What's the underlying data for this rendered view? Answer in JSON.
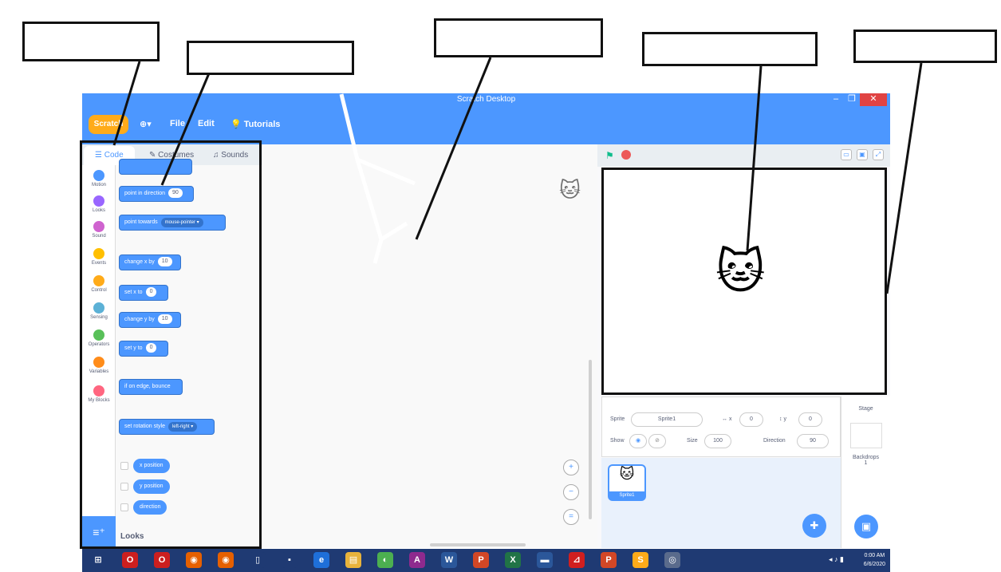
{
  "window": {
    "title": "Scratch Desktop",
    "controls": [
      "–",
      "❐",
      "✕"
    ]
  },
  "menubar": {
    "logo": "Scratch",
    "globe": "⊕▾",
    "items": [
      "File",
      "Edit",
      "Tutorials"
    ]
  },
  "tabs": [
    "Code",
    "Costumes",
    "Sounds"
  ],
  "categories": [
    {
      "label": "Motion",
      "color": "#4c97ff"
    },
    {
      "label": "Looks",
      "color": "#9966ff"
    },
    {
      "label": "Sound",
      "color": "#cf63cf"
    },
    {
      "label": "Events",
      "color": "#ffbf00"
    },
    {
      "label": "Control",
      "color": "#ffab19"
    },
    {
      "label": "Sensing",
      "color": "#5cb1d6"
    },
    {
      "label": "Operators",
      "color": "#59c059"
    },
    {
      "label": "Variables",
      "color": "#ff8c1a"
    },
    {
      "label": "My Blocks",
      "color": "#ff6680"
    }
  ],
  "blocks": {
    "point_direction": {
      "text": "point in direction",
      "value": "90"
    },
    "point_towards": {
      "text": "point towards",
      "value": "mouse-pointer ▾"
    },
    "change_x": {
      "text": "change x by",
      "value": "10"
    },
    "set_x": {
      "text": "set x to",
      "value": "0"
    },
    "change_y": {
      "text": "change y by",
      "value": "10"
    },
    "set_y": {
      "text": "set y to",
      "value": "0"
    },
    "bounce": {
      "text": "if on edge, bounce"
    },
    "rotation_style": {
      "text": "set rotation style",
      "value": "left-right ▾"
    },
    "reporters": [
      "x position",
      "y position",
      "direction"
    ],
    "next_section": "Looks"
  },
  "zoom": [
    "+",
    "−",
    "="
  ],
  "stage_header": {
    "flag": "⚑",
    "layout_buttons": [
      "▭",
      "▣",
      "⤢"
    ]
  },
  "sprite_info": {
    "sprite_label": "Sprite",
    "sprite_name": "Sprite1",
    "x_label": "↔ x",
    "x_value": "0",
    "y_label": "↕ y",
    "y_value": "0",
    "show_label": "Show",
    "size_label": "Size",
    "size_value": "100",
    "direction_label": "Direction",
    "direction_value": "90"
  },
  "sprite_list": [
    {
      "name": "Sprite1"
    }
  ],
  "stage_panel": {
    "title": "Stage",
    "backdrops_label": "Backdrops",
    "backdrops_count": "1"
  },
  "taskbar": {
    "icons": [
      {
        "glyph": "⊞",
        "color": "#1f3a73"
      },
      {
        "glyph": "O",
        "color": "#cc1f1f"
      },
      {
        "glyph": "O",
        "color": "#cc1f1f"
      },
      {
        "glyph": "◉",
        "color": "#e66000"
      },
      {
        "glyph": "◉",
        "color": "#e66000"
      },
      {
        "glyph": "▯",
        "color": "#1f3a73"
      },
      {
        "glyph": "▪",
        "color": "#1f3a73"
      },
      {
        "glyph": "e",
        "color": "#1e6fd9"
      },
      {
        "glyph": "▤",
        "color": "#e8b33c"
      },
      {
        "glyph": "◐",
        "color": "#4caf50"
      },
      {
        "glyph": "A",
        "color": "#8e2a8e"
      },
      {
        "glyph": "W",
        "color": "#2b579a"
      },
      {
        "glyph": "P",
        "color": "#d24726"
      },
      {
        "glyph": "X",
        "color": "#217346"
      },
      {
        "glyph": "▬",
        "color": "#2b579a"
      },
      {
        "glyph": "⊿",
        "color": "#d11f1f"
      },
      {
        "glyph": "P",
        "color": "#d24726"
      },
      {
        "glyph": "S",
        "color": "#ffab19"
      },
      {
        "glyph": "◎",
        "color": "#5a6b8c"
      }
    ],
    "tray": "◂ ♪ ▮",
    "time": "0:00 AM",
    "date": "6/6/2020"
  }
}
